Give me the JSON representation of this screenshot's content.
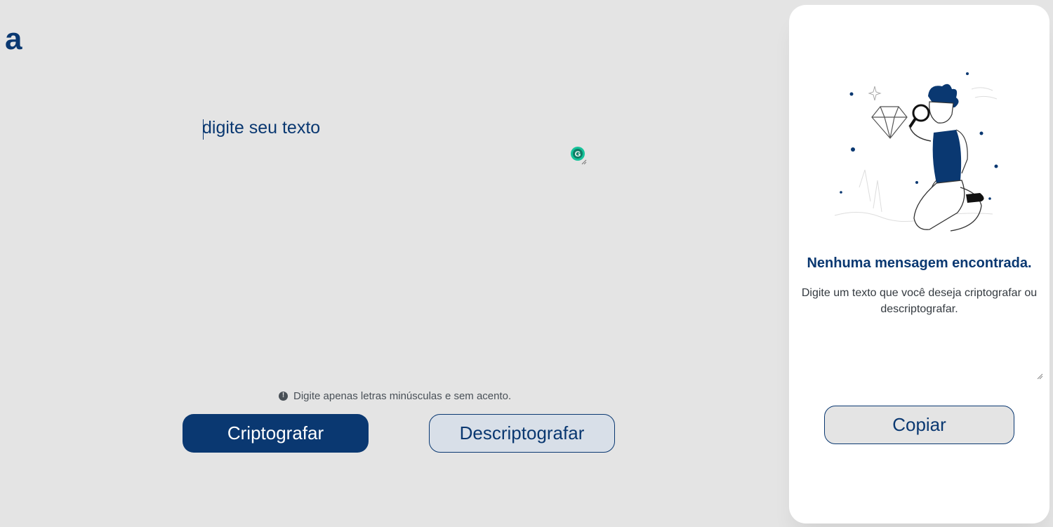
{
  "logo": {
    "letter": "a",
    "icon": "alura-logo-icon",
    "color": "#0a3871"
  },
  "editor": {
    "placeholder": "digite seu texto",
    "value": ""
  },
  "notice": {
    "icon": "exclamation-circle-icon",
    "text": "Digite apenas letras minúsculas e sem acento."
  },
  "actions": {
    "encrypt_label": "Criptografar",
    "decrypt_label": "Descriptografar"
  },
  "output_panel": {
    "illustration": "person-with-magnifying-glass-illustration",
    "title": "Nenhuma mensagem encontrada.",
    "description": "Digite um texto que você deseja criptografar ou descriptografar.",
    "copy_label": "Copiar"
  },
  "extension": {
    "icon": "grammarly-icon"
  },
  "colors": {
    "background": "#e4e4e4",
    "primary": "#0a3871",
    "panel": "#ffffff",
    "muted": "#495057"
  }
}
